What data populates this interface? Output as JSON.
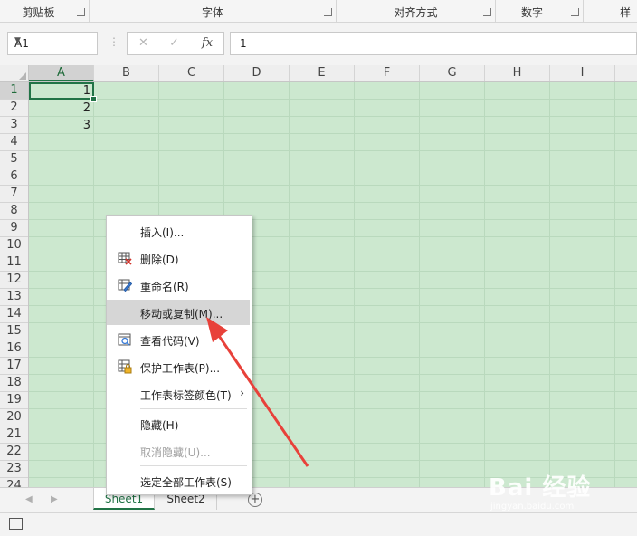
{
  "ribbon": {
    "groups": [
      {
        "label": "剪贴板"
      },
      {
        "label": "字体"
      },
      {
        "label": "对齐方式"
      },
      {
        "label": "数字"
      },
      {
        "label": "样"
      }
    ]
  },
  "formula_bar": {
    "name_box": "A1",
    "cancel_icon": "✕",
    "enter_icon": "✓",
    "fx_label": "fx",
    "content": "1"
  },
  "columns": [
    "A",
    "B",
    "C",
    "D",
    "E",
    "F",
    "G",
    "H",
    "I"
  ],
  "rows": [
    "1",
    "2",
    "3",
    "4",
    "5",
    "6",
    "7",
    "8",
    "9",
    "10",
    "11",
    "12",
    "13",
    "14",
    "15",
    "16",
    "17",
    "18",
    "19",
    "20",
    "21",
    "22",
    "23",
    "24"
  ],
  "cells": [
    {
      "ref": "A1",
      "value": "1"
    },
    {
      "ref": "A2",
      "value": "2"
    },
    {
      "ref": "A3",
      "value": "3"
    }
  ],
  "context_menu": {
    "items": [
      {
        "label": "插入(I)...",
        "icon": "none"
      },
      {
        "label": "删除(D)",
        "icon": "delete-sheet-icon"
      },
      {
        "label": "重命名(R)",
        "icon": "rename-icon"
      },
      {
        "label": "移动或复制(M)...",
        "icon": "none",
        "highlighted": true
      },
      {
        "label": "查看代码(V)",
        "icon": "view-code-icon"
      },
      {
        "label": "保护工作表(P)...",
        "icon": "protect-sheet-icon"
      },
      {
        "label": "工作表标签颜色(T)",
        "icon": "none",
        "submenu": true
      },
      {
        "label": "隐藏(H)",
        "icon": "none"
      },
      {
        "label": "取消隐藏(U)...",
        "icon": "none",
        "disabled": true
      },
      {
        "label": "选定全部工作表(S)",
        "icon": "none"
      }
    ]
  },
  "sheet_tabs": {
    "tabs": [
      {
        "label": "Sheet1",
        "active": true
      },
      {
        "label": "Sheet2",
        "active": false
      }
    ],
    "add_label": "+"
  },
  "annotation": {
    "arrow_color": "#e8413a"
  },
  "watermark": {
    "brand": "Bai 经验",
    "url": "jingyan.baidu.com"
  },
  "colors": {
    "grid_bg": "#cce8cf",
    "accent": "#217346"
  }
}
